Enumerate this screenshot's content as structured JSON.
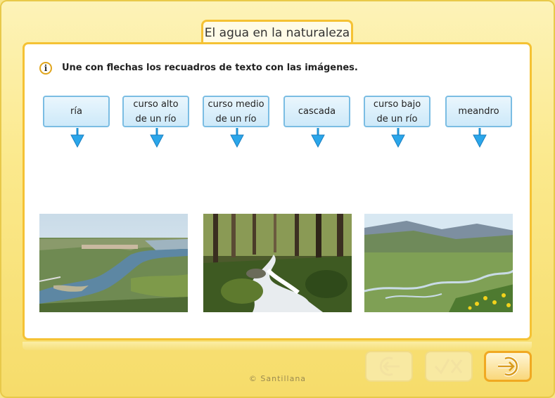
{
  "header": {
    "title": "El agua en la naturaleza"
  },
  "instruction": {
    "text": "Une con flechas los recuadros de texto con las imágenes."
  },
  "labels": [
    {
      "text": "ría"
    },
    {
      "text": "curso alto\nde un río"
    },
    {
      "text": "curso medio\nde un río"
    },
    {
      "text": "cascada"
    },
    {
      "text": "curso bajo\nde un río"
    },
    {
      "text": "meandro"
    }
  ],
  "footer": {
    "copyright": "© Santillana"
  },
  "icons": {
    "info": "info-icon",
    "arrow": "arrow-down-icon",
    "back": "back-arrow-icon",
    "check": "check-cross-icon",
    "exit": "exit-arrow-icon"
  },
  "colors": {
    "accent": "#f5c234",
    "label_border": "#7bbde3",
    "arrow": "#1f93d6"
  }
}
